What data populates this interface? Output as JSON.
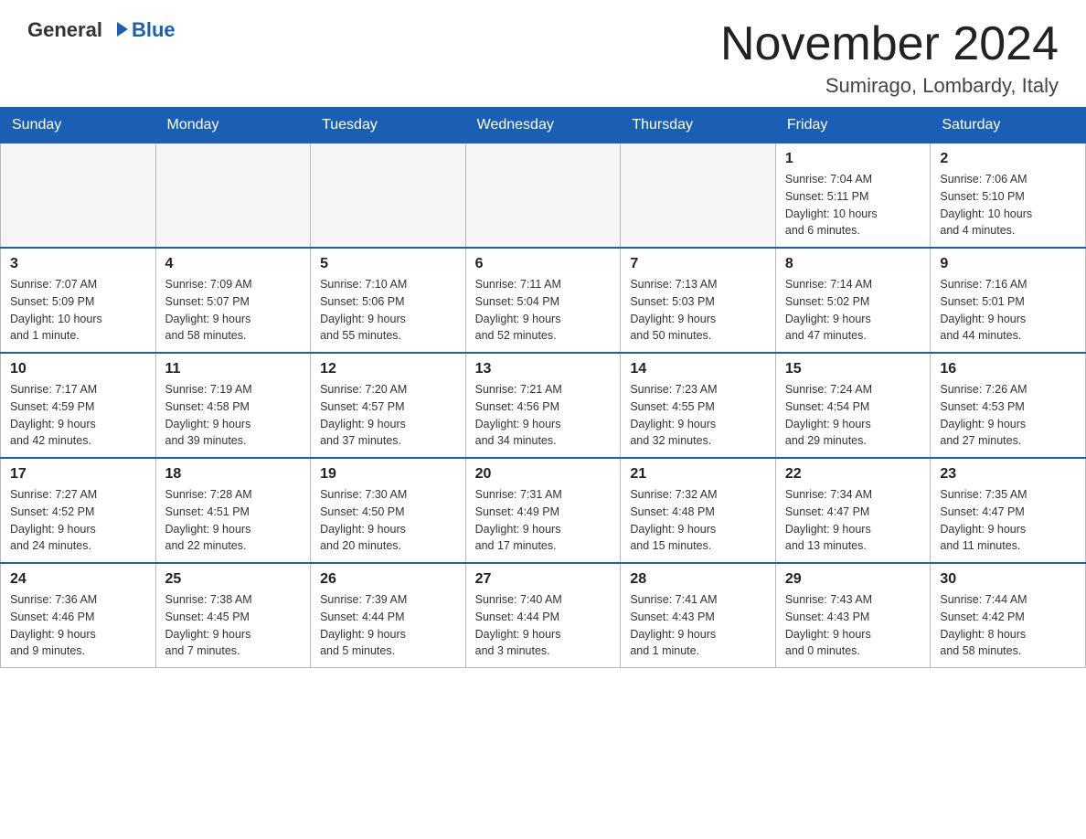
{
  "header": {
    "logo_general": "General",
    "logo_blue": "Blue",
    "month_title": "November 2024",
    "location": "Sumirago, Lombardy, Italy"
  },
  "weekdays": [
    "Sunday",
    "Monday",
    "Tuesday",
    "Wednesday",
    "Thursday",
    "Friday",
    "Saturday"
  ],
  "weeks": [
    [
      {
        "day": "",
        "info": ""
      },
      {
        "day": "",
        "info": ""
      },
      {
        "day": "",
        "info": ""
      },
      {
        "day": "",
        "info": ""
      },
      {
        "day": "",
        "info": ""
      },
      {
        "day": "1",
        "info": "Sunrise: 7:04 AM\nSunset: 5:11 PM\nDaylight: 10 hours\nand 6 minutes."
      },
      {
        "day": "2",
        "info": "Sunrise: 7:06 AM\nSunset: 5:10 PM\nDaylight: 10 hours\nand 4 minutes."
      }
    ],
    [
      {
        "day": "3",
        "info": "Sunrise: 7:07 AM\nSunset: 5:09 PM\nDaylight: 10 hours\nand 1 minute."
      },
      {
        "day": "4",
        "info": "Sunrise: 7:09 AM\nSunset: 5:07 PM\nDaylight: 9 hours\nand 58 minutes."
      },
      {
        "day": "5",
        "info": "Sunrise: 7:10 AM\nSunset: 5:06 PM\nDaylight: 9 hours\nand 55 minutes."
      },
      {
        "day": "6",
        "info": "Sunrise: 7:11 AM\nSunset: 5:04 PM\nDaylight: 9 hours\nand 52 minutes."
      },
      {
        "day": "7",
        "info": "Sunrise: 7:13 AM\nSunset: 5:03 PM\nDaylight: 9 hours\nand 50 minutes."
      },
      {
        "day": "8",
        "info": "Sunrise: 7:14 AM\nSunset: 5:02 PM\nDaylight: 9 hours\nand 47 minutes."
      },
      {
        "day": "9",
        "info": "Sunrise: 7:16 AM\nSunset: 5:01 PM\nDaylight: 9 hours\nand 44 minutes."
      }
    ],
    [
      {
        "day": "10",
        "info": "Sunrise: 7:17 AM\nSunset: 4:59 PM\nDaylight: 9 hours\nand 42 minutes."
      },
      {
        "day": "11",
        "info": "Sunrise: 7:19 AM\nSunset: 4:58 PM\nDaylight: 9 hours\nand 39 minutes."
      },
      {
        "day": "12",
        "info": "Sunrise: 7:20 AM\nSunset: 4:57 PM\nDaylight: 9 hours\nand 37 minutes."
      },
      {
        "day": "13",
        "info": "Sunrise: 7:21 AM\nSunset: 4:56 PM\nDaylight: 9 hours\nand 34 minutes."
      },
      {
        "day": "14",
        "info": "Sunrise: 7:23 AM\nSunset: 4:55 PM\nDaylight: 9 hours\nand 32 minutes."
      },
      {
        "day": "15",
        "info": "Sunrise: 7:24 AM\nSunset: 4:54 PM\nDaylight: 9 hours\nand 29 minutes."
      },
      {
        "day": "16",
        "info": "Sunrise: 7:26 AM\nSunset: 4:53 PM\nDaylight: 9 hours\nand 27 minutes."
      }
    ],
    [
      {
        "day": "17",
        "info": "Sunrise: 7:27 AM\nSunset: 4:52 PM\nDaylight: 9 hours\nand 24 minutes."
      },
      {
        "day": "18",
        "info": "Sunrise: 7:28 AM\nSunset: 4:51 PM\nDaylight: 9 hours\nand 22 minutes."
      },
      {
        "day": "19",
        "info": "Sunrise: 7:30 AM\nSunset: 4:50 PM\nDaylight: 9 hours\nand 20 minutes."
      },
      {
        "day": "20",
        "info": "Sunrise: 7:31 AM\nSunset: 4:49 PM\nDaylight: 9 hours\nand 17 minutes."
      },
      {
        "day": "21",
        "info": "Sunrise: 7:32 AM\nSunset: 4:48 PM\nDaylight: 9 hours\nand 15 minutes."
      },
      {
        "day": "22",
        "info": "Sunrise: 7:34 AM\nSunset: 4:47 PM\nDaylight: 9 hours\nand 13 minutes."
      },
      {
        "day": "23",
        "info": "Sunrise: 7:35 AM\nSunset: 4:47 PM\nDaylight: 9 hours\nand 11 minutes."
      }
    ],
    [
      {
        "day": "24",
        "info": "Sunrise: 7:36 AM\nSunset: 4:46 PM\nDaylight: 9 hours\nand 9 minutes."
      },
      {
        "day": "25",
        "info": "Sunrise: 7:38 AM\nSunset: 4:45 PM\nDaylight: 9 hours\nand 7 minutes."
      },
      {
        "day": "26",
        "info": "Sunrise: 7:39 AM\nSunset: 4:44 PM\nDaylight: 9 hours\nand 5 minutes."
      },
      {
        "day": "27",
        "info": "Sunrise: 7:40 AM\nSunset: 4:44 PM\nDaylight: 9 hours\nand 3 minutes."
      },
      {
        "day": "28",
        "info": "Sunrise: 7:41 AM\nSunset: 4:43 PM\nDaylight: 9 hours\nand 1 minute."
      },
      {
        "day": "29",
        "info": "Sunrise: 7:43 AM\nSunset: 4:43 PM\nDaylight: 9 hours\nand 0 minutes."
      },
      {
        "day": "30",
        "info": "Sunrise: 7:44 AM\nSunset: 4:42 PM\nDaylight: 8 hours\nand 58 minutes."
      }
    ]
  ]
}
